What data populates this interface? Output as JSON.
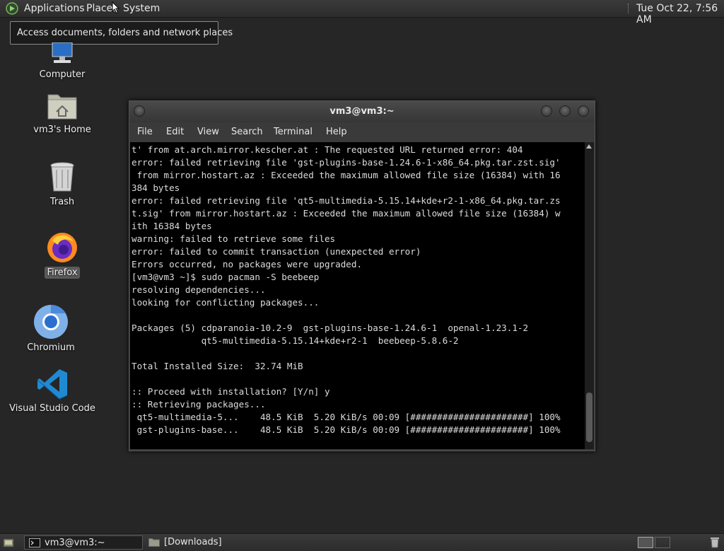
{
  "top_panel": {
    "applications": "Applications",
    "places": "Places",
    "system": "System",
    "clock": "Tue Oct 22,  7:56 AM"
  },
  "tooltip": "Access documents, folders and network places",
  "desktop_icons": {
    "computer": "Computer",
    "home": "vm3's Home",
    "trash": "Trash",
    "firefox": "Firefox",
    "chromium": "Chromium",
    "vscode": "Visual Studio Code"
  },
  "terminal": {
    "title": "vm3@vm3:~",
    "menu": {
      "file": "File",
      "edit": "Edit",
      "view": "View",
      "search": "Search",
      "terminal": "Terminal",
      "help": "Help"
    },
    "output": "t' from at.arch.mirror.kescher.at : The requested URL returned error: 404\nerror: failed retrieving file 'gst-plugins-base-1.24.6-1-x86_64.pkg.tar.zst.sig'\n from mirror.hostart.az : Exceeded the maximum allowed file size (16384) with 16\n384 bytes\nerror: failed retrieving file 'qt5-multimedia-5.15.14+kde+r2-1-x86_64.pkg.tar.zs\nt.sig' from mirror.hostart.az : Exceeded the maximum allowed file size (16384) w\nith 16384 bytes\nwarning: failed to retrieve some files\nerror: failed to commit transaction (unexpected error)\nErrors occurred, no packages were upgraded.\n[vm3@vm3 ~]$ sudo pacman -S beebeep\nresolving dependencies...\nlooking for conflicting packages...\n\nPackages (5) cdparanoia-10.2-9  gst-plugins-base-1.24.6-1  openal-1.23.1-2\n             qt5-multimedia-5.15.14+kde+r2-1  beebeep-5.8.6-2\n\nTotal Installed Size:  32.74 MiB\n\n:: Proceed with installation? [Y/n] y\n:: Retrieving packages...\n qt5-multimedia-5...    48.5 KiB  5.20 KiB/s 00:09 [######################] 100%\n gst-plugins-base...    48.5 KiB  5.20 KiB/s 00:09 [######################] 100%"
  },
  "taskbar": {
    "terminal_task": "vm3@vm3:~",
    "downloads_task": "[Downloads]"
  }
}
